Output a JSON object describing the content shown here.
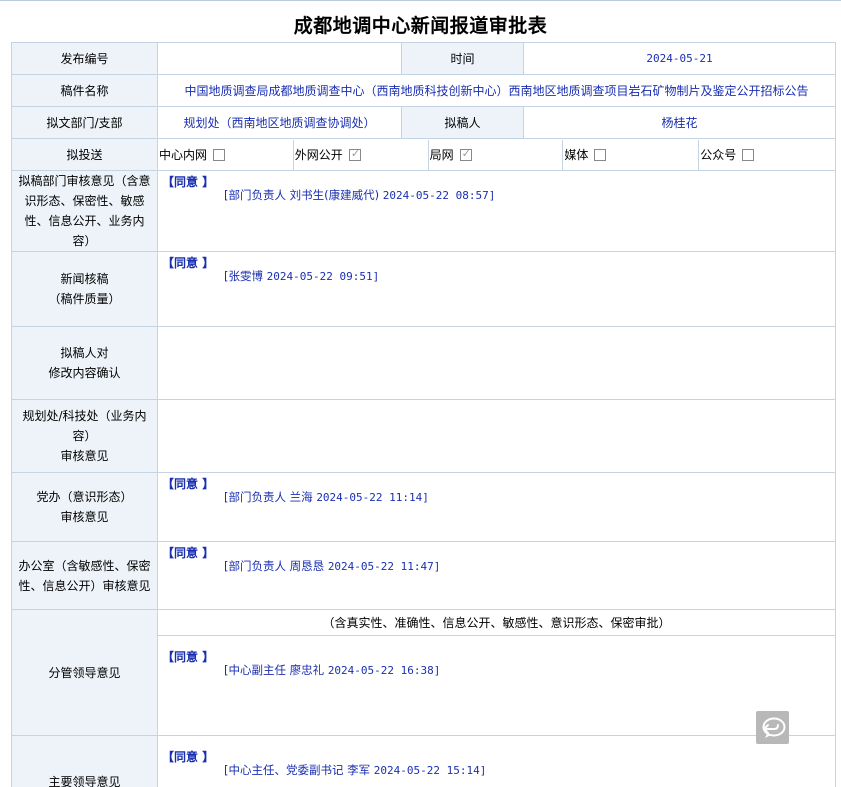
{
  "title": "成都地调中心新闻报道审批表",
  "rows": {
    "pub_no": {
      "label": "发布编号",
      "value": ""
    },
    "time": {
      "label": "时间",
      "value": "2024-05-21"
    },
    "manuscript": {
      "label": "稿件名称",
      "value": "中国地质调查局成都地质调查中心（西南地质科技创新中心）西南地区地质调查项目岩石矿物制片及鉴定公开招标公告"
    },
    "dept": {
      "label": "拟文部门/支部",
      "value": "规划处（西南地区地质调查协调处）"
    },
    "author": {
      "label": "拟稿人",
      "value": "杨桂花"
    },
    "send": {
      "label": "拟投送",
      "options": [
        {
          "label": "中心内网",
          "checked": false
        },
        {
          "label": "外网公开",
          "checked": true
        },
        {
          "label": "局网",
          "checked": true
        },
        {
          "label": "媒体",
          "checked": false
        },
        {
          "label": "公众号",
          "checked": false
        }
      ]
    },
    "dept_review": {
      "label": "拟稿部门审核意见（含意识形态、保密性、敏感性、信息公开、业务内容）",
      "agree": "【同意 】",
      "signer": "[部门负责人 刘书生(康建威代)",
      "ts": "2024-05-22 08:57]"
    },
    "news_review": {
      "label1": "新闻核稿",
      "label2": "（稿件质量）",
      "agree": "【同意 】",
      "signer": "[张雯博",
      "ts": "2024-05-22 09:51]"
    },
    "author_confirm": {
      "label1": "拟稿人对",
      "label2": "修改内容确认"
    },
    "planning_review": {
      "label1": "规划处/科技处（业务内容）",
      "label2": "审核意见"
    },
    "party_review": {
      "label1": "党办（意识形态）",
      "label2": "审核意见",
      "agree": "【同意 】",
      "signer": "[部门负责人 兰海",
      "ts": "2024-05-22 11:14]"
    },
    "office_review": {
      "label": "办公室（含敏感性、保密性、信息公开）审核意见",
      "agree": "【同意 】",
      "signer": "[部门负责人 周恳恳",
      "ts": "2024-05-22 11:47]"
    },
    "leader_review": {
      "label": "分管领导意见",
      "note": "（含真实性、准确性、信息公开、敏感性、意识形态、保密审批）",
      "agree": "【同意 】",
      "signer": "[中心副主任 廖忠礼",
      "ts": "2024-05-22 16:38]"
    },
    "main_leader": {
      "label": "主要领导意见",
      "agree": "【同意 】",
      "signer": "[中心主任、党委副书记 李军",
      "ts": "2024-05-22 15:14]"
    }
  },
  "icons": {
    "fab": "reply-icon"
  },
  "colors": {
    "label_bg": "#eef3f9",
    "border": "#c5d3e2",
    "value_text": "#1a2fb0"
  }
}
